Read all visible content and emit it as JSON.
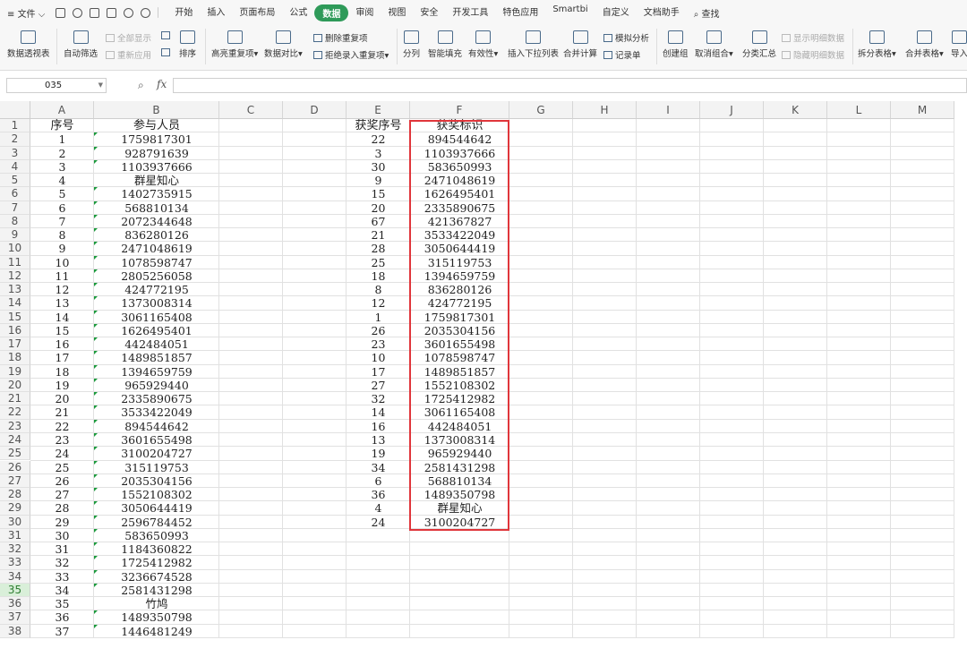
{
  "menu": {
    "file": "文件",
    "tabs": [
      "开始",
      "插入",
      "页面布局",
      "公式",
      "数据",
      "审阅",
      "视图",
      "安全",
      "开发工具",
      "特色应用",
      "Smartbi",
      "自定义",
      "文档助手"
    ],
    "active_tab": "数据",
    "search": "查找"
  },
  "ribbon": {
    "pivot": "数据透视表",
    "autofilter": "自动筛选",
    "show_all": "全部显示",
    "reapply": "重新应用",
    "sort": "排序",
    "highlight_dup": "高亮重复项",
    "compare": "数据对比",
    "delete_dup": "删除重复项",
    "reject_dup": "拒绝录入重复项",
    "split": "分列",
    "smart_fill": "智能填充",
    "validity": "有效性",
    "dropdown": "插入下拉列表",
    "consolidate": "合并计算",
    "whatif": "模拟分析",
    "record": "记录单",
    "create_group": "创建组",
    "ungroup": "取消组合",
    "subtotal": "分类汇总",
    "show_detail": "显示明细数据",
    "hide_detail": "隐藏明细数据",
    "split_table": "拆分表格",
    "merge_table": "合并表格",
    "import": "导入"
  },
  "formula_bar": {
    "name_box": "035",
    "fx": "fx",
    "formula": ""
  },
  "sheet": {
    "columns": [
      "A",
      "B",
      "C",
      "D",
      "E",
      "F",
      "G",
      "H",
      "I",
      "J",
      "K",
      "L",
      "M"
    ],
    "rows": [
      "1",
      "2",
      "3",
      "4",
      "5",
      "6",
      "7",
      "8",
      "9",
      "10",
      "11",
      "12",
      "13",
      "14",
      "15",
      "16",
      "17",
      "18",
      "19",
      "20",
      "21",
      "22",
      "23",
      "24",
      "25",
      "26",
      "27",
      "28",
      "29",
      "30",
      "31",
      "32",
      "33",
      "34",
      "35",
      "36",
      "37",
      "38"
    ],
    "selected_row": "35",
    "header_A": "序号",
    "header_B": "参与人员",
    "header_E": "获奖序号",
    "header_F": "获奖标识",
    "col_A": [
      "1",
      "2",
      "3",
      "4",
      "5",
      "6",
      "7",
      "8",
      "9",
      "10",
      "11",
      "12",
      "13",
      "14",
      "15",
      "16",
      "17",
      "18",
      "19",
      "20",
      "21",
      "22",
      "23",
      "24",
      "25",
      "26",
      "27",
      "28",
      "29",
      "30",
      "31",
      "32",
      "33",
      "34",
      "35",
      "36",
      "37"
    ],
    "col_B": [
      "1759817301",
      "928791639",
      "1103937666",
      "群星知心",
      "1402735915",
      "568810134",
      "2072344648",
      "836280126",
      "2471048619",
      "1078598747",
      "2805256058",
      "424772195",
      "1373008314",
      "3061165408",
      "1626495401",
      "442484051",
      "1489851857",
      "1394659759",
      "965929440",
      "2335890675",
      "3533422049",
      "894544642",
      "3601655498",
      "3100204727",
      "315119753",
      "2035304156",
      "1552108302",
      "3050644419",
      "2596784452",
      "583650993",
      "1184360822",
      "1725412982",
      "3236674528",
      "2581431298",
      "竹鸠",
      "1489350798",
      "1446481249"
    ],
    "col_E": [
      "22",
      "3",
      "30",
      "9",
      "15",
      "20",
      "67",
      "21",
      "28",
      "25",
      "18",
      "8",
      "12",
      "1",
      "26",
      "23",
      "10",
      "17",
      "27",
      "32",
      "14",
      "16",
      "13",
      "19",
      "34",
      "6",
      "36",
      "4",
      "24"
    ],
    "col_F": [
      "894544642",
      "1103937666",
      "583650993",
      "2471048619",
      "1626495401",
      "2335890675",
      "421367827",
      "3533422049",
      "3050644419",
      "315119753",
      "1394659759",
      "836280126",
      "424772195",
      "1759817301",
      "2035304156",
      "3601655498",
      "1078598747",
      "1489851857",
      "1552108302",
      "1725412982",
      "3061165408",
      "442484051",
      "1373008314",
      "965929440",
      "2581431298",
      "568810134",
      "1489350798",
      "群星知心",
      "3100204727"
    ]
  }
}
